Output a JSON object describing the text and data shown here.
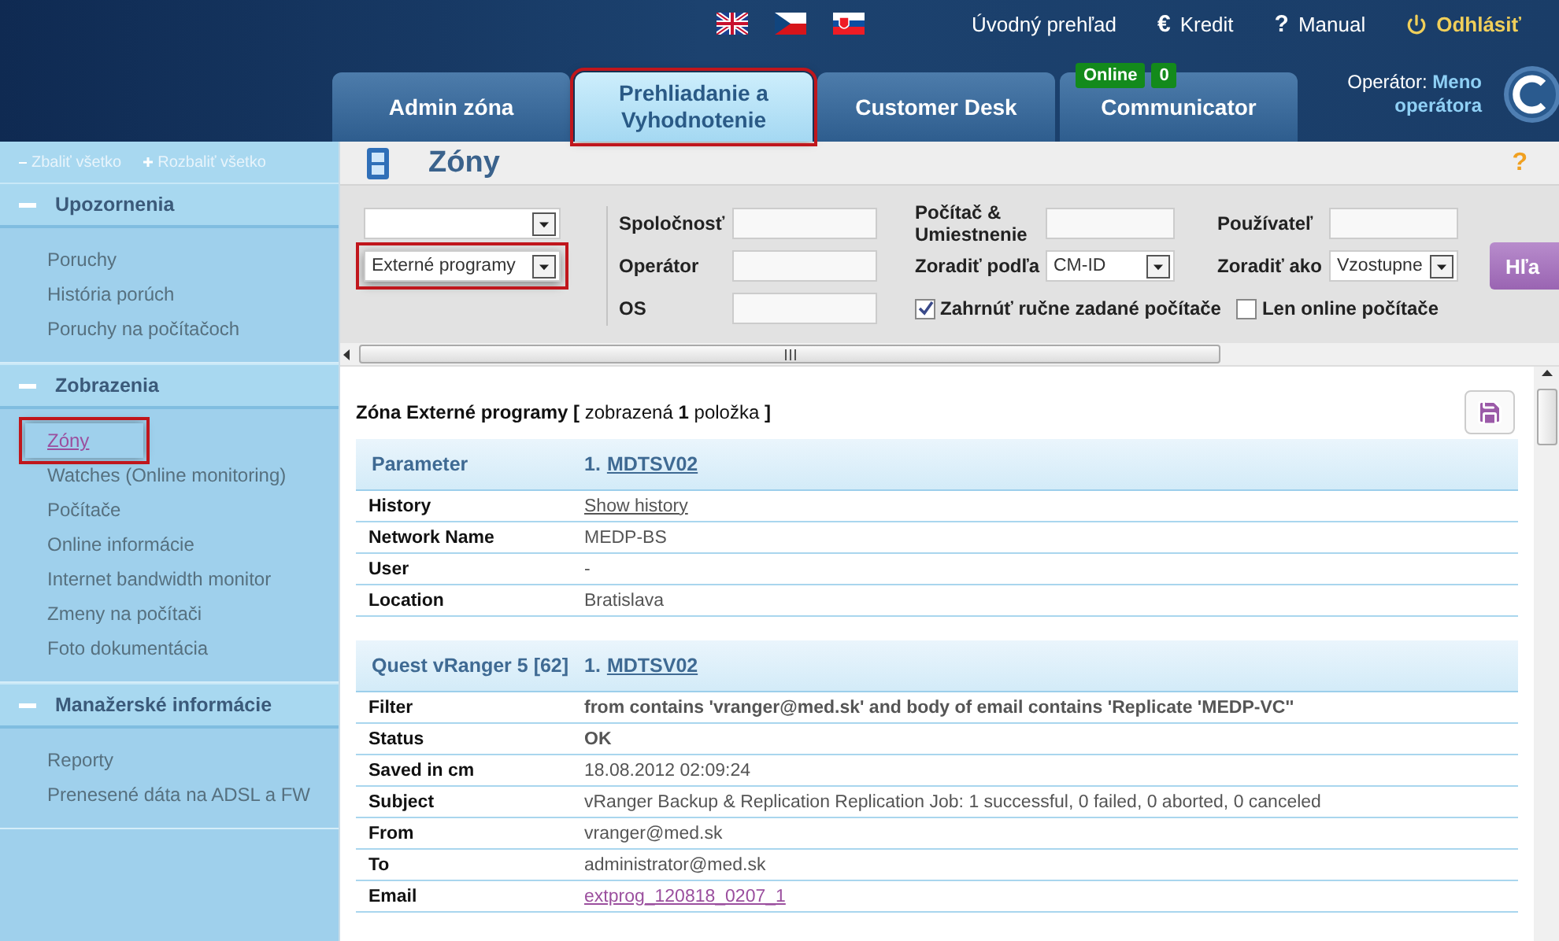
{
  "header": {
    "languages": [
      {
        "kind": "uk"
      },
      {
        "kind": "cz"
      },
      {
        "kind": "sk"
      }
    ],
    "links": [
      {
        "kind": "plain",
        "label": "Úvodný prehľad"
      },
      {
        "kind": "glyph",
        "icon": "€",
        "label": "Kredit"
      },
      {
        "kind": "glyph",
        "icon": "?",
        "label": "Manual"
      },
      {
        "kind": "power",
        "label": "Odhlásiť"
      }
    ],
    "tabs": [
      {
        "label": "Admin zóna",
        "selected": false,
        "highlighted": false
      },
      {
        "label": "Prehliadanie a Vyhodnotenie",
        "selected": true,
        "highlighted": true
      },
      {
        "label": "Customer Desk",
        "selected": false,
        "highlighted": false
      },
      {
        "label": "Communicator",
        "selected": false,
        "highlighted": false,
        "badges": [
          "Online",
          "0"
        ]
      }
    ],
    "operator": {
      "label": "Operátor:",
      "name": "Meno operátora"
    }
  },
  "sidebar": {
    "collapse_all": "Zbaliť všetko",
    "expand_all": "Rozbaliť všetko",
    "sections": [
      {
        "title": "Upozornenia",
        "expanded": true,
        "items": [
          {
            "label": "Poruchy",
            "selected": false,
            "highlighted": false
          },
          {
            "label": "História porúch",
            "selected": false,
            "highlighted": false
          },
          {
            "label": "Poruchy na počítačoch",
            "selected": false,
            "highlighted": false
          }
        ]
      },
      {
        "title": "Zobrazenia",
        "expanded": true,
        "items": [
          {
            "label": "Zóny",
            "selected": true,
            "highlighted": true
          },
          {
            "label": "Watches (Online monitoring)",
            "selected": false,
            "highlighted": false
          },
          {
            "label": "Počítače",
            "selected": false,
            "highlighted": false
          },
          {
            "label": "Online informácie",
            "selected": false,
            "highlighted": false
          },
          {
            "label": "Internet bandwidth monitor",
            "selected": false,
            "highlighted": false
          },
          {
            "label": "Zmeny na počítači",
            "selected": false,
            "highlighted": false
          },
          {
            "label": "Foto dokumentácia",
            "selected": false,
            "highlighted": false
          }
        ]
      },
      {
        "title": "Manažerské informácie",
        "expanded": true,
        "items": [
          {
            "label": "Reporty",
            "selected": false,
            "highlighted": false
          },
          {
            "label": "Prenesené dáta na ADSL a FW",
            "selected": false,
            "highlighted": false
          }
        ]
      }
    ]
  },
  "main": {
    "title": "Zóny",
    "help": "?",
    "filter": {
      "selects": [
        {
          "highlighted": false
        },
        {
          "value": "Externé programy",
          "highlighted": true
        }
      ],
      "columns": [
        [
          {
            "label": "Spoločnosť",
            "kind": "input"
          },
          {
            "label": "Operátor",
            "kind": "input"
          },
          {
            "label": "OS",
            "kind": "input"
          }
        ],
        [
          {
            "label": "Počítač & Umiestnenie",
            "kind": "input"
          },
          {
            "label": "Zoradiť podľa",
            "kind": "select",
            "value": "CM-ID"
          }
        ],
        [
          {
            "label": "Používateľ",
            "kind": "input"
          },
          {
            "label": "Zoradiť ako",
            "kind": "select",
            "value": "Vzostupne"
          }
        ]
      ],
      "checkboxes": [
        {
          "label": "Zahrnúť ručne zadané počítače",
          "checked": true
        },
        {
          "label": "Len online počítače",
          "checked": false
        }
      ],
      "button": "Hľa"
    },
    "heading": "**Zóna Externé programy [** zobrazená **1** položka **]**",
    "sections": [
      {
        "header": "Parameter",
        "number": "1.",
        "link": "MDTSV02",
        "rows": [
          {
            "label": "History",
            "value": "Show history",
            "kind": "link"
          },
          {
            "label": "Network Name",
            "value": "MEDP-BS",
            "kind": "text"
          },
          {
            "label": "User",
            "value": "-",
            "kind": "text"
          },
          {
            "label": "Location",
            "value": "Bratislava",
            "kind": "text"
          }
        ]
      },
      {
        "header": "Quest vRanger 5 [62]",
        "number": "1.",
        "link": "MDTSV02",
        "rows": [
          {
            "label": "Filter",
            "value": "from contains 'vranger@med.sk' and body of email contains 'Replicate 'MEDP-VC''",
            "kind": "bold"
          },
          {
            "label": "Status",
            "value": "OK",
            "kind": "bold"
          },
          {
            "label": "Saved in cm",
            "value": "18.08.2012 02:09:24",
            "kind": "text"
          },
          {
            "label": "Subject",
            "value": "vRanger Backup & Replication Replication Job: 1 successful, 0 failed, 0 aborted, 0 canceled",
            "kind": "text"
          },
          {
            "label": "From",
            "value": "vranger@med.sk",
            "kind": "text"
          },
          {
            "label": "To",
            "value": "administrator@med.sk",
            "kind": "text"
          },
          {
            "label": "Email",
            "value": "extprog_120818_0207_1",
            "kind": "visited"
          }
        ]
      }
    ]
  }
}
